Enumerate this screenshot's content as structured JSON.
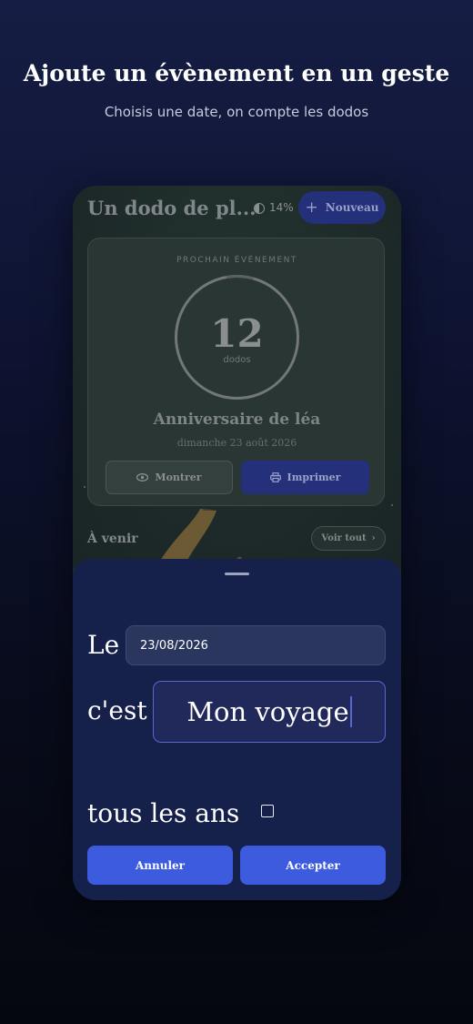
{
  "promo": {
    "headline": "Ajoute un évènement en un geste",
    "subheadline": "Choisis une date, on compte les dodos"
  },
  "app": {
    "title": "Un dodo de pl...",
    "moon_percent": "14%",
    "new_button": "Nouveau",
    "next_event": {
      "kicker": "PROCHAIN ÉVÉNEMENT",
      "count": "12",
      "unit": "dodos",
      "title": "Anniversaire de léa",
      "date": "dimanche 23 août 2026",
      "show_button": "Montrer",
      "print_button": "Imprimer"
    },
    "upcoming": {
      "title": "À venir",
      "see_all": "Voir tout"
    }
  },
  "sheet": {
    "date_label": "Le",
    "date_value": "23/08/2026",
    "name_label": "c'est",
    "name_value": "Mon voyage",
    "yearly_label": "tous les ans",
    "yearly_checked": false,
    "cancel_button": "Annuler",
    "accept_button": "Accepter"
  },
  "colors": {
    "accent": "#3d5bdf",
    "sheet_bg": "#15204b",
    "focus_border": "#5866cf"
  }
}
